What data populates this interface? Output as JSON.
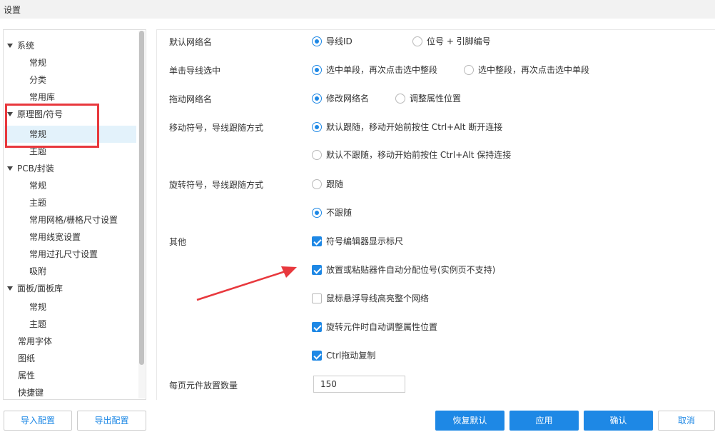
{
  "window": {
    "title": "设置"
  },
  "sidebar": {
    "items": [
      {
        "label": "系统",
        "level": 0,
        "expanded": true
      },
      {
        "label": "常规",
        "level": 1
      },
      {
        "label": "分类",
        "level": 1
      },
      {
        "label": "常用库",
        "level": 1
      },
      {
        "label": "原理图/符号",
        "level": 0,
        "expanded": true
      },
      {
        "label": "常规",
        "level": 1,
        "selected": true
      },
      {
        "label": "主题",
        "level": 1
      },
      {
        "label": "PCB/封装",
        "level": 0,
        "expanded": true
      },
      {
        "label": "常规",
        "level": 1
      },
      {
        "label": "主题",
        "level": 1
      },
      {
        "label": "常用网格/栅格尺寸设置",
        "level": 1
      },
      {
        "label": "常用线宽设置",
        "level": 1
      },
      {
        "label": "常用过孔尺寸设置",
        "level": 1
      },
      {
        "label": "吸附",
        "level": 1
      },
      {
        "label": "面板/面板库",
        "level": 0,
        "expanded": true
      },
      {
        "label": "常规",
        "level": 1
      },
      {
        "label": "主题",
        "level": 1
      },
      {
        "label": "常用字体",
        "level": 0
      },
      {
        "label": "图纸",
        "level": 0
      },
      {
        "label": "属性",
        "level": 0
      },
      {
        "label": "快捷键",
        "level": 0
      }
    ]
  },
  "settings": {
    "default_net_name": {
      "label": "默认网络名",
      "options": [
        "导线ID",
        "位号 + 引脚编号"
      ],
      "selected": 0
    },
    "click_wire_select": {
      "label": "单击导线选中",
      "options": [
        "选中单段，再次点击选中整段",
        "选中整段，再次点击选中单段"
      ],
      "selected": 0
    },
    "drag_net_name": {
      "label": "拖动网络名",
      "options": [
        "修改网络名",
        "调整属性位置"
      ],
      "selected": 0
    },
    "move_symbol_wire": {
      "label": "移动符号，导线跟随方式",
      "options": [
        "默认跟随，移动开始前按住 Ctrl+Alt 断开连接",
        "默认不跟随，移动开始前按住 Ctrl+Alt 保持连接"
      ],
      "selected": 0
    },
    "rotate_symbol_wire": {
      "label": "旋转符号，导线跟随方式",
      "options": [
        "跟随",
        "不跟随"
      ],
      "selected": 1
    },
    "other": {
      "label": "其他",
      "checks": [
        {
          "label": "符号编辑器显示标尺",
          "checked": true
        },
        {
          "label": "放置或粘贴器件自动分配位号(实例页不支持)",
          "checked": true
        },
        {
          "label": "鼠标悬浮导线高亮整个网络",
          "checked": false
        },
        {
          "label": "旋转元件时自动调整属性位置",
          "checked": true
        },
        {
          "label": "Ctrl拖动复制",
          "checked": true
        }
      ]
    },
    "parts_per_page": {
      "label": "每页元件放置数量",
      "value": "150"
    }
  },
  "footer": {
    "import_label": "导入配置",
    "export_label": "导出配置",
    "reset_label": "恢复默认",
    "apply_label": "应用",
    "ok_label": "确认",
    "cancel_label": "取消"
  },
  "colors": {
    "accent": "#1e88e5",
    "highlight_box": "#e8383d",
    "annotation_arrow": "#e8383d"
  }
}
